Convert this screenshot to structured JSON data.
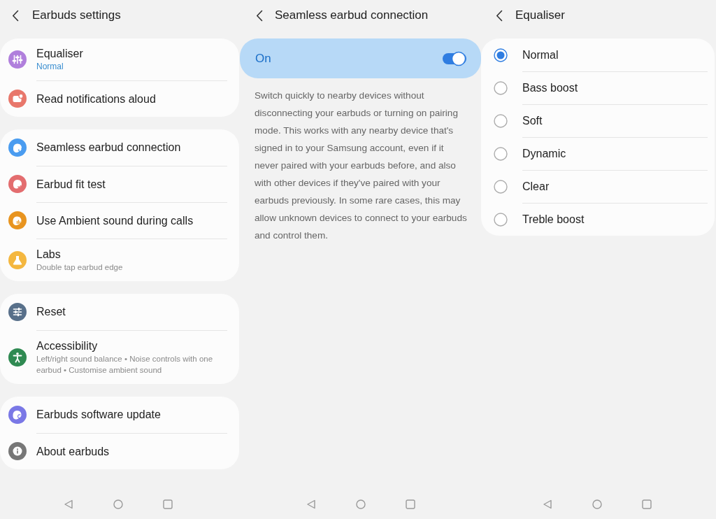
{
  "earbuds_settings": {
    "title": "Earbuds settings",
    "groups": [
      {
        "items": [
          {
            "label": "Equaliser",
            "value": "Normal",
            "color": "#b07fdc"
          },
          {
            "label": "Read notifications aloud",
            "color": "#e8776b"
          }
        ]
      },
      {
        "items": [
          {
            "label": "Seamless earbud connection",
            "color": "#4a9cf0"
          },
          {
            "label": "Earbud fit test",
            "color": "#e36d6f"
          },
          {
            "label": "Use Ambient sound during calls",
            "color": "#e8941f"
          },
          {
            "label": "Labs",
            "summary": "Double tap earbud edge",
            "color": "#f4b73f"
          }
        ]
      },
      {
        "items": [
          {
            "label": "Reset",
            "color": "#58708a"
          },
          {
            "label": "Accessibility",
            "summary": "Left/right sound balance • Noise controls with one earbud • Customise ambient sound",
            "color": "#2f8a52"
          }
        ]
      },
      {
        "items": [
          {
            "label": "Earbuds software update",
            "color": "#7a78e6"
          },
          {
            "label": "About earbuds",
            "color": "#777777"
          }
        ]
      }
    ]
  },
  "seamless_earbud_connection": {
    "title": "Seamless earbud connection",
    "toggle": {
      "label": "On",
      "on": true
    },
    "description": "Switch quickly to nearby devices without disconnecting your earbuds or turning on pairing mode. This works with any nearby device that's signed in to your Samsung account, even if it never paired with your earbuds before, and also with other devices if they've paired with your earbuds previously. In some rare cases, this may allow unknown devices to connect to your earbuds and control them."
  },
  "equaliser": {
    "title": "Equaliser",
    "options": [
      {
        "label": "Normal",
        "selected": true
      },
      {
        "label": "Bass boost",
        "selected": false
      },
      {
        "label": "Soft",
        "selected": false
      },
      {
        "label": "Dynamic",
        "selected": false
      },
      {
        "label": "Clear",
        "selected": false
      },
      {
        "label": "Treble boost",
        "selected": false
      }
    ]
  }
}
